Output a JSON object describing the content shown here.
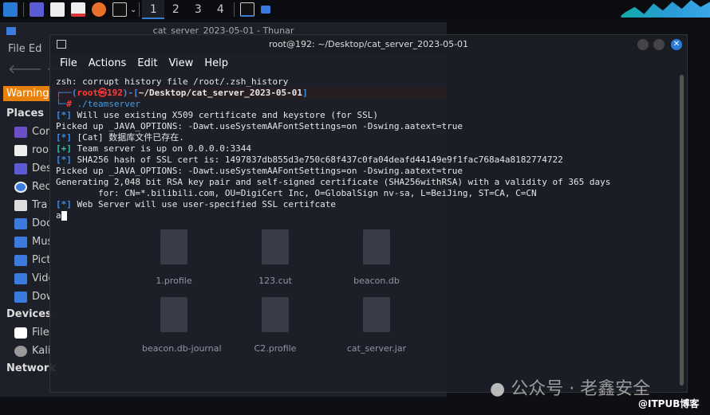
{
  "taskbar": {
    "workspaces": [
      "1",
      "2",
      "3",
      "4"
    ]
  },
  "thunar": {
    "title": "cat_server_2023-05-01 - Thunar",
    "menu": [
      "File",
      "Ed"
    ],
    "warning": "Warning",
    "places_heading": "Places",
    "places": [
      "Cor",
      "roo",
      "Des",
      "Rec",
      "Tra",
      "Documents",
      "Music",
      "Pictures",
      "Videos",
      "Downloads"
    ],
    "devices_heading": "Devices",
    "devices": [
      "File System",
      "Kali Linux"
    ],
    "network_heading": "Network",
    "files": [
      "1.profile",
      "123.cut",
      "beacon.db",
      "beacon.db-journal",
      "C2.profile",
      "cat_server.jar"
    ]
  },
  "terminal": {
    "title": "root@192: ~/Desktop/cat_server_2023-05-01",
    "menu": [
      "File",
      "Actions",
      "Edit",
      "View",
      "Help"
    ],
    "lines": {
      "l1": "zsh: corrupt history file /root/.zsh_history",
      "user": "root",
      "host": "192",
      "cwd": "~/Desktop/cat_server_2023-05-01",
      "cmd": "./teamserver",
      "l3": " Will use existing X509 certificate and keystore (for SSL)",
      "l4": "Picked up _JAVA_OPTIONS: -Dawt.useSystemAAFontSettings=on -Dswing.aatext=true",
      "l5": " [Cat] 数据库文件已存在.",
      "l6": " Team server is up on 0.0.0.0:3344",
      "l7": " SHA256 hash of SSL cert is: 1497837db855d3e750c68f437c0fa04deafd44149e9f1fac768a4a8182774722",
      "l8": "Picked up _JAVA_OPTIONS: -Dawt.useSystemAAFontSettings=on -Dswing.aatext=true",
      "l9": "Generating 2,048 bit RSA key pair and self-signed certificate (SHA256withRSA) with a validity of 365 days",
      "l10": "        for: CN=*.bilibili.com, OU=DigiCert Inc, O=GlobalSign nv-sa, L=BeiJing, ST=CA, C=CN",
      "l11": " Web Server will use user-specified SSL certifcate",
      "l12": "a"
    },
    "tag_star": "[*]",
    "tag_plus": "[+]"
  },
  "watermark": {
    "main": "公众号 · 老鑫安全",
    "sub": "@ITPUB博客"
  }
}
